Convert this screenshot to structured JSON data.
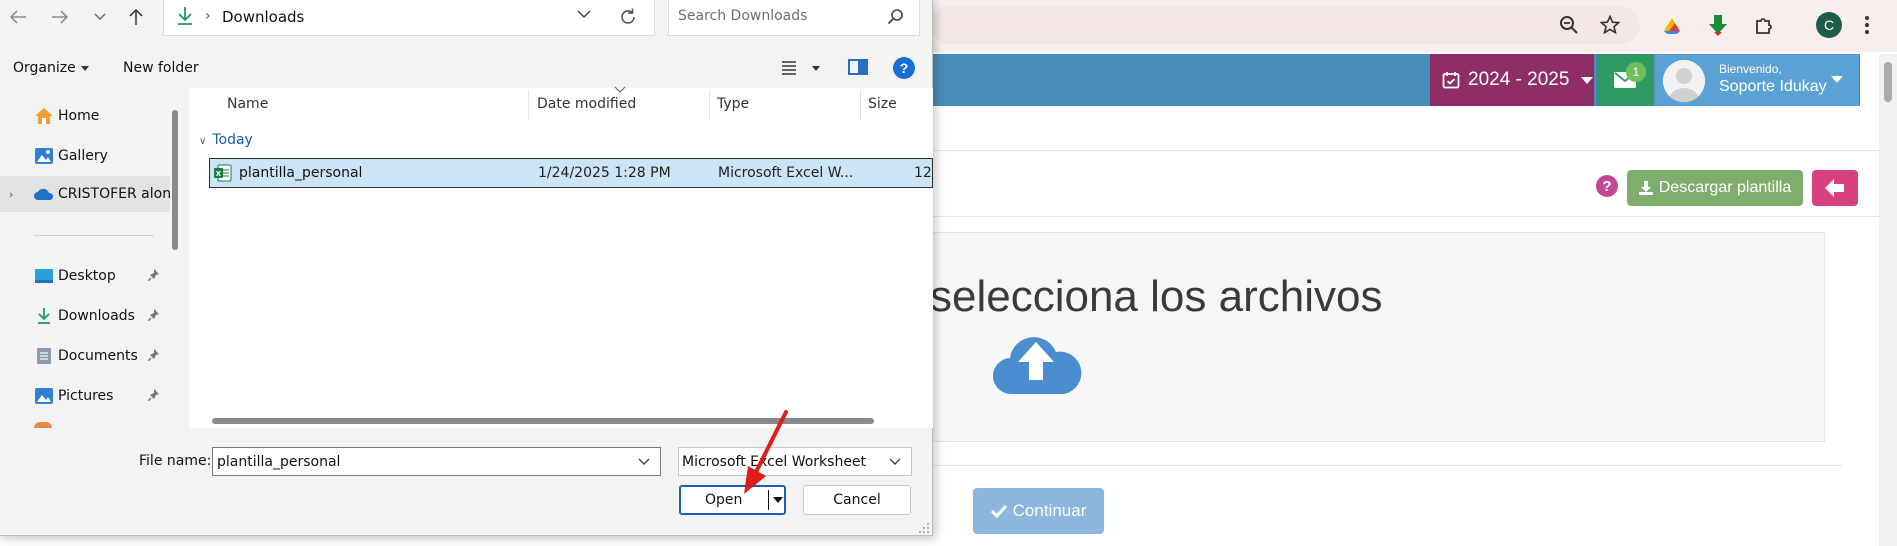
{
  "browser": {
    "colors": {
      "chrome_bg": "#f8eeee",
      "accent": "#4a8db8"
    },
    "avatar_letter": "C",
    "icons": [
      "zoom-icon",
      "star-icon",
      "extension-color-icon",
      "download-arrow-icon",
      "puzzle-icon",
      "menu-dots-icon"
    ]
  },
  "app": {
    "year_label": "2024 - 2025",
    "mail_count": "1",
    "user_welcome": "Bienvenido,",
    "user_name": "Soporte Idukay",
    "help_glyph": "?",
    "download_template_label": "Descargar plantilla",
    "drop_text": "selecciona los archivos",
    "continue_label": "Continuar",
    "colors": {
      "year": "#8e2d66",
      "mail": "#2e9a62",
      "user": "#5aa2d3",
      "download": "#7fad6e",
      "back": "#d8407f",
      "continue": "#8cb6de",
      "cloud": "#4a8ed0"
    }
  },
  "dialog": {
    "address": {
      "location": "Downloads",
      "separator": "›"
    },
    "search_placeholder": "Search Downloads",
    "toolbar": {
      "organize": "Organize",
      "new_folder": "New folder",
      "help_glyph": "?"
    },
    "nav": {
      "items": [
        {
          "label": "Home",
          "icon": "home-icon"
        },
        {
          "label": "Gallery",
          "icon": "gallery-icon"
        },
        {
          "label": "CRISTOFER alon",
          "icon": "onedrive-cloud-icon",
          "selected": true
        },
        {
          "label": "Desktop",
          "icon": "desktop-icon",
          "pinned": true
        },
        {
          "label": "Downloads",
          "icon": "downloads-icon",
          "pinned": true
        },
        {
          "label": "Documents",
          "icon": "documents-icon",
          "pinned": true
        },
        {
          "label": "Pictures",
          "icon": "pictures-icon",
          "pinned": true
        }
      ]
    },
    "columns": {
      "name": "Name",
      "date": "Date modified",
      "type": "Type",
      "size": "Size"
    },
    "group": "Today",
    "files": [
      {
        "name": "plantilla_personal",
        "date": "1/24/2025 1:28 PM",
        "type": "Microsoft Excel W...",
        "size": "12"
      }
    ],
    "file_name_label": "File name:",
    "file_name_value": "plantilla_personal",
    "file_type_value": "Microsoft Excel Worksheet",
    "open_label": "Open",
    "cancel_label": "Cancel",
    "colors": {
      "selection": "#cce4f7",
      "open_border": "#1a5fb4",
      "annotation_arrow": "#e01b1b"
    }
  }
}
